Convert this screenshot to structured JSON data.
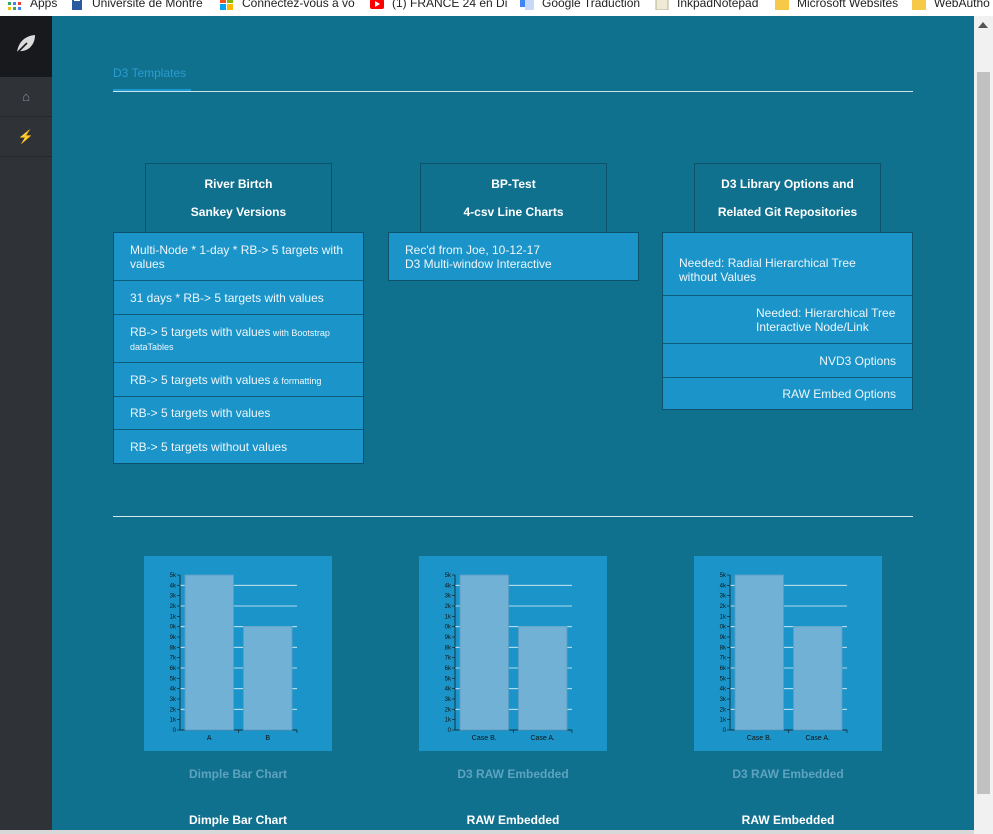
{
  "bookmarks": [
    {
      "label": "Apps",
      "icon": "apps-grid-icon",
      "color": "#4285f4"
    },
    {
      "label": "Université de Montré",
      "icon": "university-icon",
      "color": "#2c5aa0"
    },
    {
      "label": "Connectez-vous à vo",
      "icon": "windows-icon",
      "color": "#f25022"
    },
    {
      "label": "(1) FRANCE 24 en Di",
      "icon": "youtube-icon",
      "color": "#ff0000"
    },
    {
      "label": "Google Traduction",
      "icon": "translate-icon",
      "color": "#4285f4"
    },
    {
      "label": "InkpadNotepad",
      "icon": "page-icon",
      "color": "#e8e4d0"
    },
    {
      "label": "Microsoft Websites",
      "icon": "folder-icon",
      "color": "#f7c948"
    },
    {
      "label": "WebAutho",
      "icon": "folder-icon",
      "color": "#f7c948"
    }
  ],
  "sidebar": {
    "logo_icon": "leaf-icon",
    "items": [
      {
        "icon": "home-icon",
        "glyph": "⌂"
      },
      {
        "icon": "bolt-icon",
        "glyph": "⚡"
      }
    ]
  },
  "tabs": [
    {
      "label": "D3 Templates"
    }
  ],
  "columns": [
    {
      "title": [
        "River Birtch",
        "Sankey Versions"
      ],
      "items": [
        {
          "main": "Multi-Node * 1-day * RB-> 5 targets with values",
          "small": ""
        },
        {
          "main": "31 days * RB-> 5 targets with values",
          "small": ""
        },
        {
          "main": "RB-> 5 targets with values",
          "small": " with Bootstrap dataTables"
        },
        {
          "main": "RB-> 5 targets with values",
          "small": " & formatting"
        },
        {
          "main": "RB-> 5 targets with values",
          "small": ""
        },
        {
          "main": "RB-> 5 targets without values",
          "small": ""
        }
      ]
    },
    {
      "title": [
        "BP-Test",
        "4-csv Line Charts"
      ],
      "items": [
        {
          "line1": "Rec'd from Joe, 10-12-17",
          "line2": "D3 Multi-window Interactive"
        }
      ]
    },
    {
      "title": [
        "D3 Library Options and",
        "Related Git Repositories"
      ],
      "items": [
        {
          "main": "Needed: Radial Hierarchical Tree without Values"
        },
        {
          "main": "Needed: Hierarchical Tree Interactive Node/Link"
        },
        {
          "main": "NVD3 Options"
        },
        {
          "main": "RAW Embed Options"
        }
      ]
    }
  ],
  "thumbnails": [
    {
      "caption": "Dimple Bar Chart",
      "label": "Dimple Bar Chart"
    },
    {
      "caption": "D3 RAW Embedded",
      "label": "RAW Embedded"
    },
    {
      "caption": "D3 RAW Embedded",
      "label": "RAW Embedded"
    }
  ],
  "chart_data": [
    {
      "type": "bar",
      "categories": [
        "A",
        "B"
      ],
      "values": [
        15,
        10
      ],
      "yticks": [
        "0",
        "1k",
        "2k",
        "3k",
        "4k",
        "5k",
        "6k",
        "7k",
        "8k",
        "9k",
        "0k",
        "1k",
        "2k",
        "3k",
        "4k",
        "5k"
      ],
      "ylim": [
        0,
        15
      ],
      "grid": true
    },
    {
      "type": "bar",
      "categories": [
        "Case B.",
        "Case A."
      ],
      "values": [
        15,
        10
      ],
      "yticks": [
        "0",
        "1k",
        "2k",
        "3k",
        "4k",
        "5k",
        "6k",
        "7k",
        "8k",
        "9k",
        "0k",
        "1k",
        "2k",
        "3k",
        "4k",
        "5k"
      ],
      "ylim": [
        0,
        15
      ],
      "grid": true
    },
    {
      "type": "bar",
      "categories": [
        "Case B.",
        "Case A."
      ],
      "values": [
        15,
        10
      ],
      "yticks": [
        "0",
        "1k",
        "2k",
        "3k",
        "4k",
        "5k",
        "6k",
        "7k",
        "8k",
        "9k",
        "0k",
        "1k",
        "2k",
        "3k",
        "4k",
        "5k"
      ],
      "ylim": [
        0,
        15
      ],
      "grid": true
    }
  ]
}
